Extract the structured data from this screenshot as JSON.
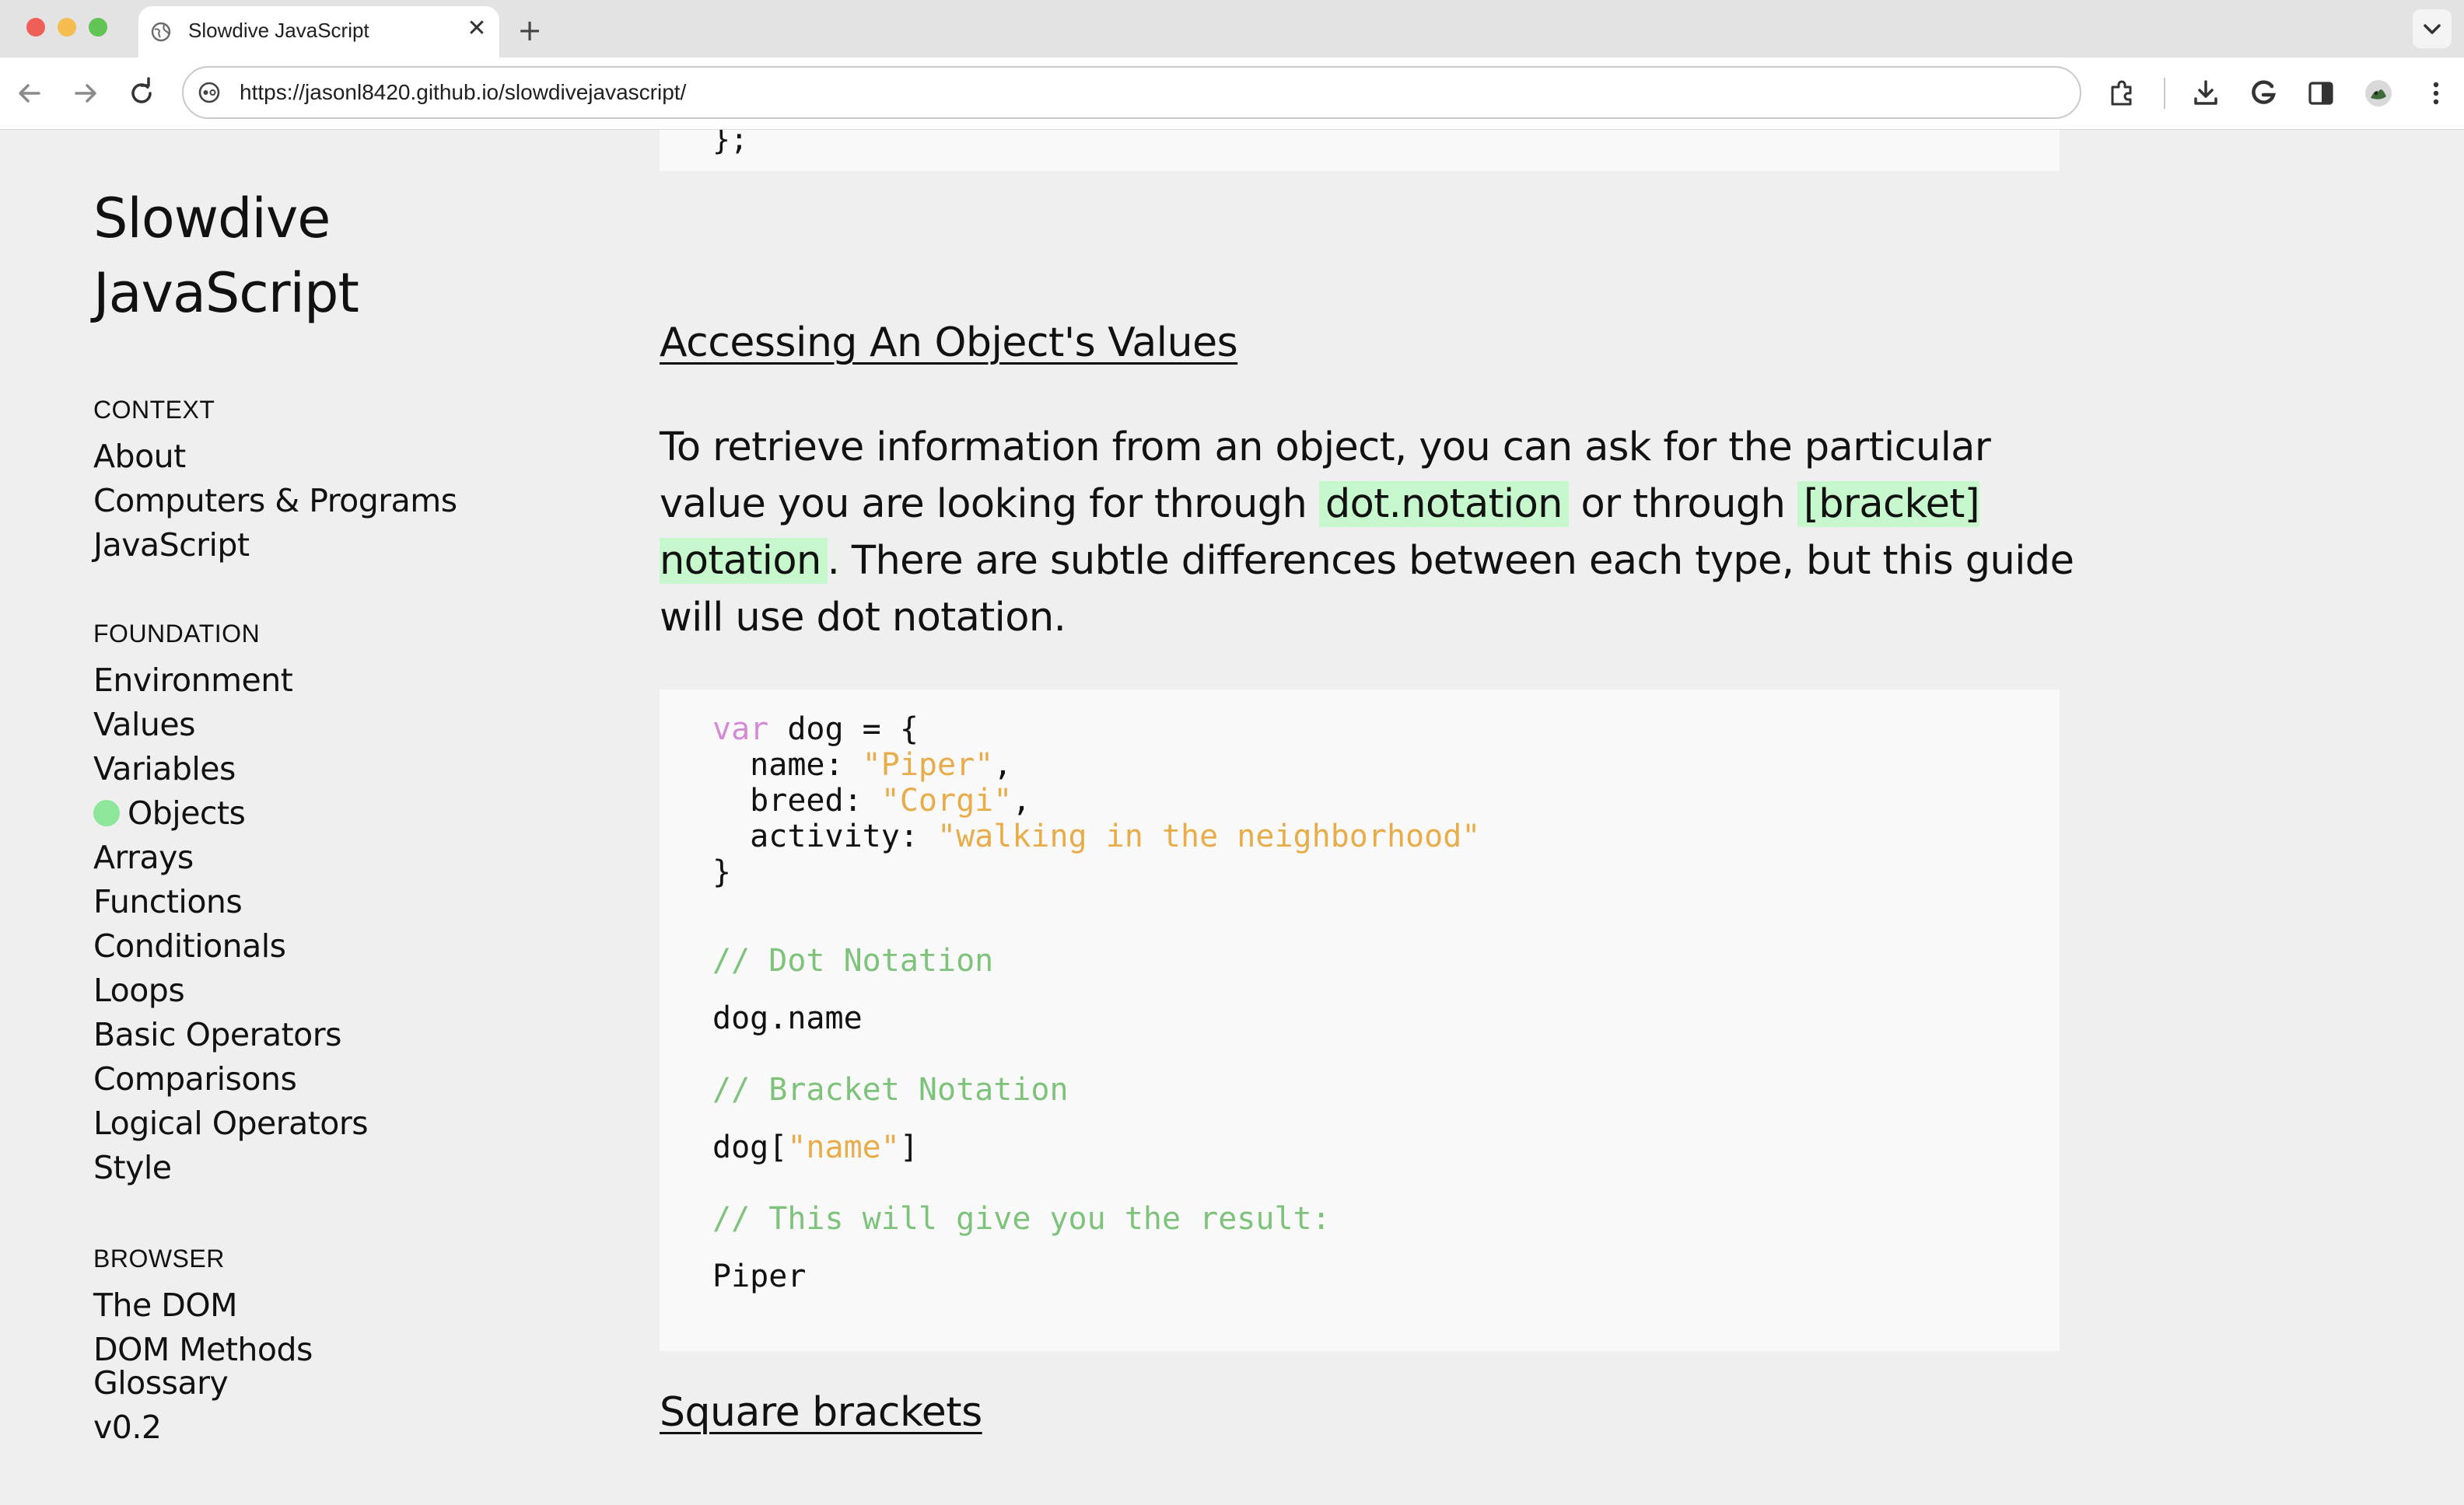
{
  "browser": {
    "tab_title": "Slowdive JavaScript",
    "tab_close": "✕",
    "new_tab": "+",
    "url": "https://jasonl8420.github.io/slowdivejavascript/"
  },
  "colors": {
    "accent_green": "#8ee69a",
    "highlight_green": "#c7f7cc",
    "code_keyword": "#d48bd6",
    "code_string": "#e8ad4a",
    "code_comment": "#7ec27b",
    "page_background": "#efefef",
    "code_background": "#f9f9f9"
  },
  "sidebar": {
    "title": "Slowdive JavaScript",
    "sections": [
      {
        "heading": "CONTEXT",
        "items": [
          "About",
          "Computers & Programs",
          "JavaScript"
        ]
      },
      {
        "heading": "FOUNDATION",
        "items": [
          "Environment",
          "Values",
          "Variables",
          "Objects",
          "Arrays",
          "Functions",
          "Conditionals",
          "Loops",
          "Basic Operators",
          "Comparisons",
          "Logical Operators",
          "Style"
        ]
      },
      {
        "heading": "BROWSER",
        "items": [
          "The DOM",
          "DOM Methods"
        ]
      },
      {
        "heading": "",
        "items": [
          "Glossary",
          "v0.2"
        ]
      }
    ],
    "active_item": "Objects"
  },
  "content": {
    "prev_code_tail": "};",
    "heading": "Accessing An Object's Values",
    "intro": {
      "part1": "To retrieve information from an object, you can ask for the particular value you are looking for through ",
      "highlight1": "dot.notation",
      "part2": " or through ",
      "highlight2": "[bracket] notation",
      "part3": ". There are subtle differences between each type, but this guide will use dot notation."
    },
    "code": {
      "kw_var": "var",
      "decl": " dog = {",
      "prop_name": "  name: ",
      "val_name": "\"Piper\"",
      "prop_breed": "  breed: ",
      "val_breed": "\"Corgi\"",
      "prop_activity": "  activity: ",
      "val_activity": "\"walking in the neighborhood\"",
      "comma": ",",
      "close": "}",
      "comment_dot": "// Dot Notation",
      "dot_expr": "dog.name",
      "comment_bracket": "// Bracket Notation",
      "bracket_open": "dog[",
      "bracket_key": "\"name\"",
      "bracket_close": "]",
      "comment_result": "// This will give you the result:",
      "result": "Piper"
    },
    "next_heading": "Square brackets"
  }
}
